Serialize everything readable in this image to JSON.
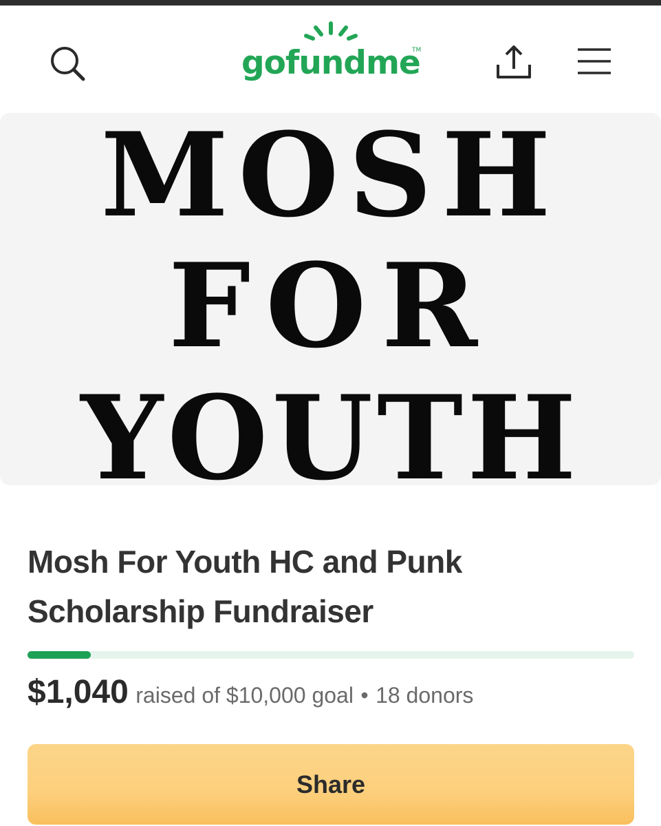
{
  "header": {
    "logo_text": "gofundme",
    "logo_tm": "TM",
    "icons": {
      "search": "search-icon",
      "share": "share-upload-icon",
      "menu": "hamburger-menu-icon"
    },
    "brand_color": "#22a656"
  },
  "hero": {
    "lines": [
      "MOSH",
      "FOR",
      "YOUTH"
    ]
  },
  "campaign": {
    "title": "Mosh For Youth HC and Punk Scholarship Fundraiser",
    "raised": "$1,040",
    "raised_suffix": "raised of $10,000 goal",
    "separator": "•",
    "donors": "18 donors",
    "progress_fraction": 0.104,
    "progress_color": "#1ea055"
  },
  "actions": {
    "share_label": "Share",
    "share_color": "#fccf7c"
  }
}
